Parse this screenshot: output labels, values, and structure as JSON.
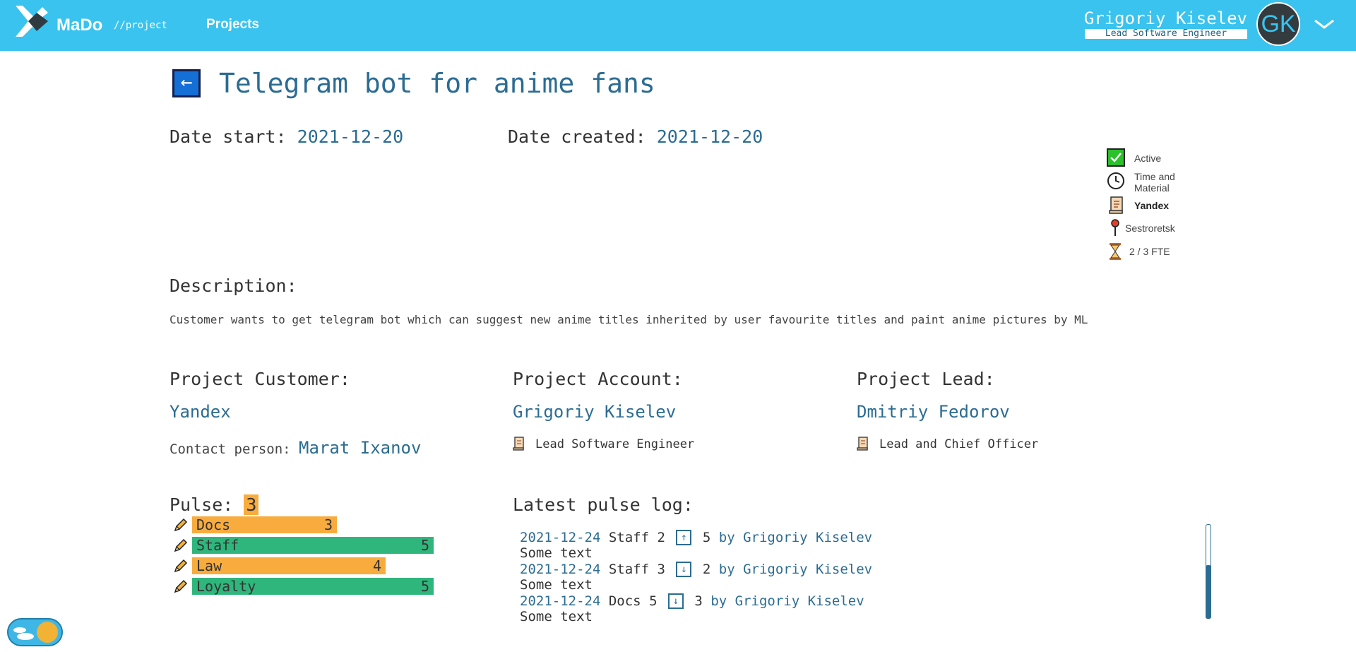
{
  "header": {
    "logo_text": "MaDo",
    "logo_sub": "//project",
    "nav_projects": "Projects",
    "user_name": "Grigoriy Kiselev",
    "user_role": "Lead Software Engineer",
    "avatar_initials": "GK"
  },
  "project": {
    "back_symbol": "←",
    "title": "Telegram bot for anime fans",
    "date_start_label": "Date start:",
    "date_start": "2021-12-20",
    "date_created_label": "Date created:",
    "date_created": "2021-12-20"
  },
  "info": {
    "status": "Active",
    "billing": "Time and Material",
    "customer": "Yandex",
    "location": "Sestroretsk",
    "fte": "2 / 3 FTE"
  },
  "description": {
    "heading": "Description:",
    "text": "Customer wants to get telegram bot which can suggest new anime titles inherited by user favourite titles and paint anime pictures by ML"
  },
  "customer": {
    "heading": "Project Customer:",
    "name": "Yandex",
    "contact_label": "Contact person:",
    "contact_name": "Marat Ixanov"
  },
  "account": {
    "heading": "Project Account:",
    "name": "Grigoriy Kiselev",
    "role": "Lead Software Engineer"
  },
  "lead": {
    "heading": "Project Lead:",
    "name": "Dmitriy Fedorov",
    "role": "Lead and Chief Officer"
  },
  "pulse": {
    "heading": "Pulse:",
    "value": "3",
    "max": 5,
    "items": [
      {
        "name": "Docs",
        "value": "3",
        "color": "#f8ac3e"
      },
      {
        "name": "Staff",
        "value": "5",
        "color": "#2fb67c"
      },
      {
        "name": "Law",
        "value": "4",
        "color": "#f8ac3e"
      },
      {
        "name": "Loyalty",
        "value": "5",
        "color": "#2fb67c"
      }
    ]
  },
  "pulse_log": {
    "heading": "Latest pulse log:",
    "entries": [
      {
        "date": "2021-12-24",
        "category": "Staff",
        "from": "2",
        "arrow": "↑",
        "to": "5",
        "by": "by Grigoriy Kiselev",
        "text": "Some text"
      },
      {
        "date": "2021-12-24",
        "category": "Staff",
        "from": "3",
        "arrow": "↓",
        "to": "2",
        "by": "by Grigoriy Kiselev",
        "text": "Some text"
      },
      {
        "date": "2021-12-24",
        "category": "Docs",
        "from": "5",
        "arrow": "↓",
        "to": "3",
        "by": "by Grigoriy Kiselev",
        "text": "Some text"
      }
    ]
  }
}
